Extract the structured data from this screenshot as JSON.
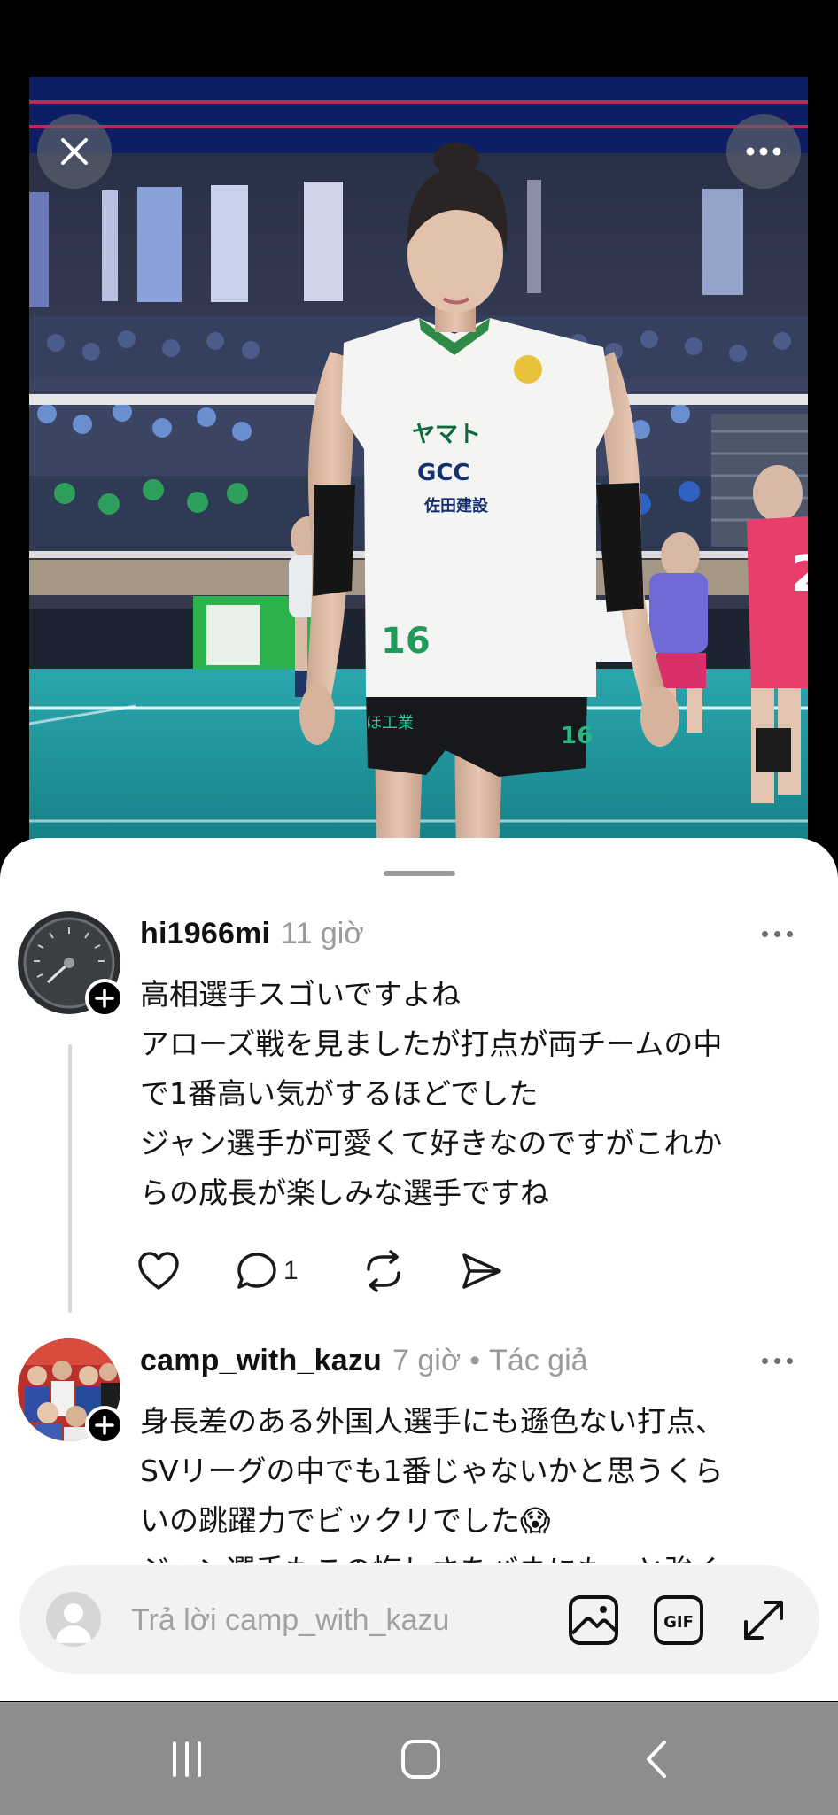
{
  "photo": {
    "alt_subject": "volleyball player",
    "jersey_sponsor_1": "ヤマト",
    "jersey_sponsor_2": "GCC",
    "jersey_sponsor_3": "佐田建設",
    "jersey_number": "16",
    "opponent_number": "2"
  },
  "viewer": {
    "close_icon": "close-icon",
    "more_icon": "more-horizontal-icon"
  },
  "comments": [
    {
      "username": "hi1966mi",
      "timestamp": "11 giờ",
      "author_tag": "",
      "text_lines": [
        "高相選手スゴいですよね",
        "アローズ戦を見ましたが打点が両チームの中",
        "で1番高い気がするほどでした",
        "ジャン選手が可愛くて好きなのですがこれか",
        "らの成長が楽しみな選手ですね"
      ],
      "reply_count": "1"
    },
    {
      "username": "camp_with_kazu",
      "timestamp": "7 giờ",
      "separator": "•",
      "author_tag": "Tác giả",
      "text_lines": [
        "身長差のある外国人選手にも遜色ない打点、",
        "SVリーグの中でも1番じゃないかと思うくら",
        "いの跳躍力でビックリでした😱",
        "ジャン選手もこの悔しさをバネにもっと強く"
      ]
    }
  ],
  "composer": {
    "placeholder": "Trả lời camp_with_kazu",
    "gif_label": "GIF",
    "icons": [
      "avatar-placeholder-icon",
      "image-icon",
      "gif-icon",
      "expand-icon"
    ]
  },
  "system_nav": {
    "icons": [
      "recents-icon",
      "home-icon",
      "back-icon"
    ]
  },
  "colors": {
    "background": "#000000",
    "sheet": "#ffffff",
    "username": "#111111",
    "muted": "#9a9a9a",
    "nav_bar": "#8d8d8d",
    "court": "#1b8f95"
  }
}
